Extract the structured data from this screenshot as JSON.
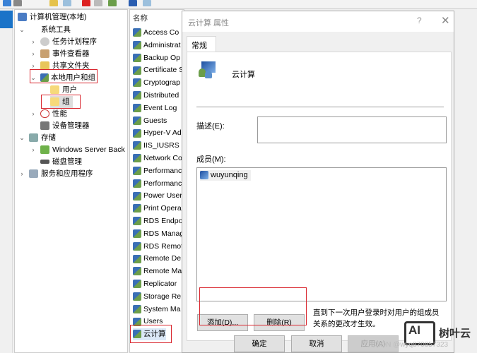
{
  "tree": {
    "root": "计算机管理(本地)",
    "items": [
      {
        "label": "系统工具"
      },
      {
        "label": "任务计划程序"
      },
      {
        "label": "事件查看器"
      },
      {
        "label": "共享文件夹"
      },
      {
        "label": "本地用户和组"
      },
      {
        "label": "用户"
      },
      {
        "label": "组"
      },
      {
        "label": "性能"
      },
      {
        "label": "设备管理器"
      },
      {
        "label": "存储"
      },
      {
        "label": "Windows Server Back"
      },
      {
        "label": "磁盘管理"
      },
      {
        "label": "服务和应用程序"
      }
    ]
  },
  "list": {
    "header": "名称",
    "items": [
      "Access Co",
      "Administrat",
      "Backup Op",
      "Certificate S",
      "Cryptograp",
      "Distributed",
      "Event Log",
      "Guests",
      "Hyper-V Ad",
      "IIS_IUSRS",
      "Network Co",
      "Performanc",
      "Performanc",
      "Power User",
      "Print Opera",
      "RDS Endpo",
      "RDS Manag",
      "RDS Remot",
      "Remote De",
      "Remote Ma",
      "Replicator",
      "Storage Re",
      "System Ma",
      "Users",
      "云计算"
    ]
  },
  "dialog": {
    "title": "云计算 属性",
    "help": "?",
    "close": "✕",
    "tab": "常规",
    "group_name": "云计算",
    "description_label": "描述(E):",
    "description_value": "",
    "members_label": "成员(M):",
    "members": [
      "wuyunqing"
    ],
    "add_button": "添加(D)...",
    "remove_button": "删除(R)",
    "note": "直到下一次用户登录时对用户的组成员关系的更改才生效。",
    "ok_button": "确定",
    "cancel_button": "取消",
    "apply_button": "应用(A)"
  },
  "watermark": {
    "logo": "AI",
    "brand": "树叶云",
    "csdn": "CSDN @wyq870857323"
  }
}
